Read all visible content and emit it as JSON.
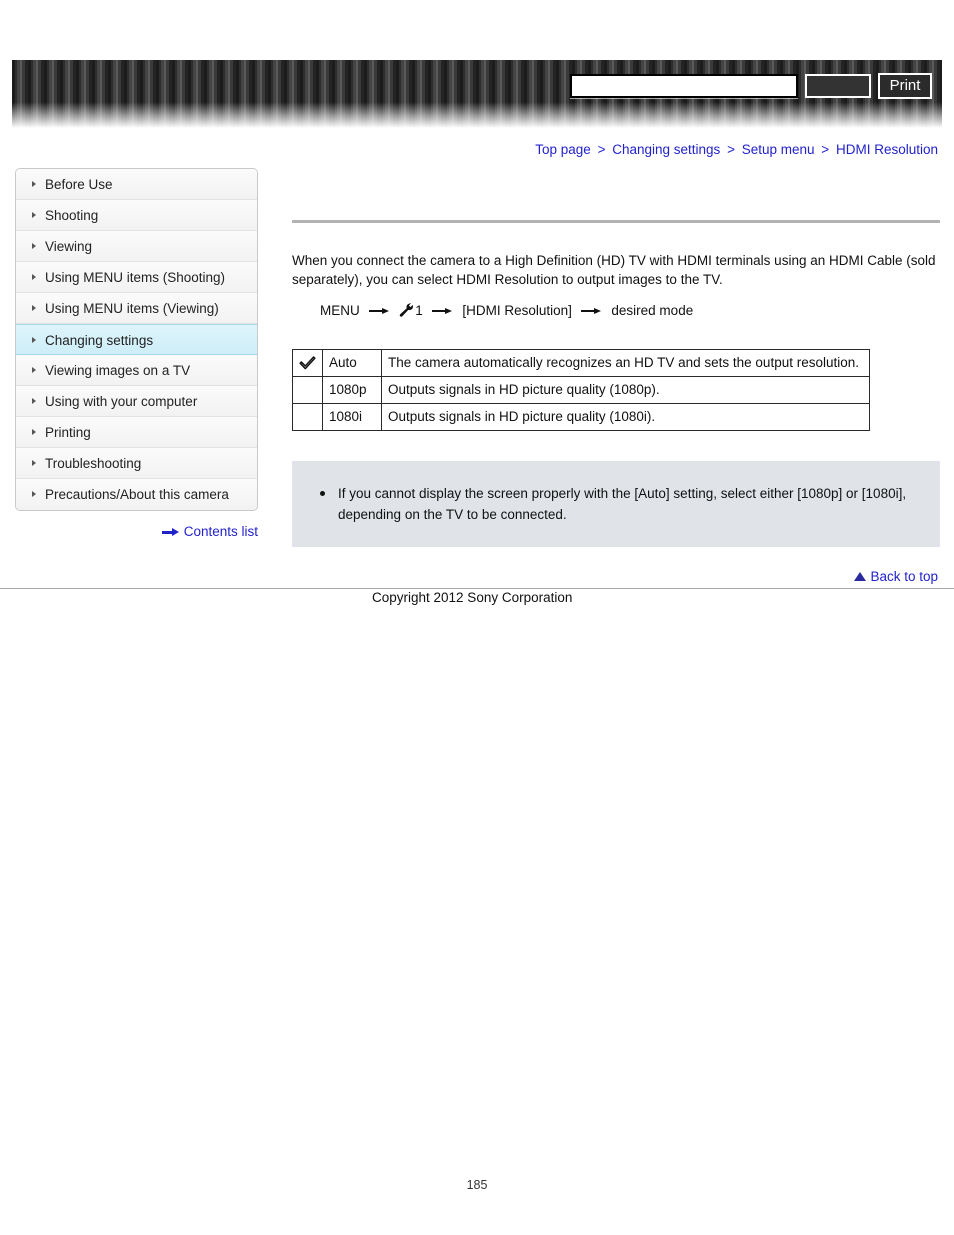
{
  "header": {
    "search_value": "",
    "search_placeholder": "",
    "search_button_label": "",
    "print_button_label": "Print"
  },
  "breadcrumb": {
    "separator": ">",
    "items": [
      {
        "label": "Top page"
      },
      {
        "label": "Changing settings"
      },
      {
        "label": "Setup menu"
      },
      {
        "label": "HDMI Resolution"
      }
    ]
  },
  "sidebar": {
    "items": [
      {
        "label": "Before Use",
        "active": false
      },
      {
        "label": "Shooting",
        "active": false
      },
      {
        "label": "Viewing",
        "active": false
      },
      {
        "label": "Using MENU items (Shooting)",
        "active": false
      },
      {
        "label": "Using MENU items (Viewing)",
        "active": false
      },
      {
        "label": "Changing settings",
        "active": true
      },
      {
        "label": "Viewing images on a TV",
        "active": false
      },
      {
        "label": "Using with your computer",
        "active": false
      },
      {
        "label": "Printing",
        "active": false
      },
      {
        "label": "Troubleshooting",
        "active": false
      },
      {
        "label": "Precautions/About this camera",
        "active": false
      }
    ],
    "contents_list_label": "Contents list"
  },
  "main": {
    "intro": "When you connect the camera to a High Definition (HD) TV with HDMI terminals using an HDMI Cable (sold separately), you can select HDMI Resolution to output images to the TV.",
    "menu_path": {
      "start": "MENU",
      "setup_number": "1",
      "item": "[HDMI Resolution]",
      "end": "desired mode"
    },
    "table": {
      "rows": [
        {
          "checked": true,
          "name": "Auto",
          "description": "The camera automatically recognizes an HD TV and sets the output resolution."
        },
        {
          "checked": false,
          "name": "1080p",
          "description": "Outputs signals in HD picture quality (1080p)."
        },
        {
          "checked": false,
          "name": "1080i",
          "description": "Outputs signals in HD picture quality (1080i)."
        }
      ]
    },
    "note": {
      "items": [
        "If you cannot display the screen properly with the [Auto] setting, select either [1080p] or [1080i], depending on the TV to be connected."
      ]
    }
  },
  "footer": {
    "back_to_top_label": "Back to top",
    "copyright": "Copyright 2012 Sony Corporation",
    "page_number": "185"
  },
  "colors": {
    "link": "#2222cc",
    "active_nav": "#cdeef8",
    "note_bg": "#e0e4e9"
  }
}
